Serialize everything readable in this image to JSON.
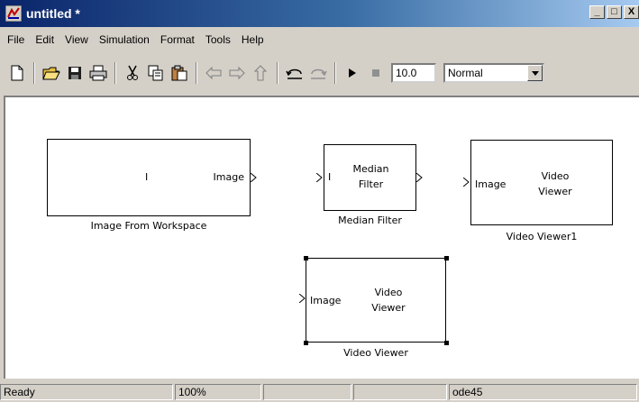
{
  "window": {
    "title": "untitled *",
    "buttons": [
      "_",
      "□",
      "X"
    ]
  },
  "menu": [
    "File",
    "Edit",
    "View",
    "Simulation",
    "Format",
    "Tools",
    "Help"
  ],
  "toolbar": {
    "icons": [
      "new-file-icon",
      "open-folder-icon",
      "save-icon",
      "print-icon",
      "cut-icon",
      "copy-icon",
      "paste-icon",
      "back-arrow-icon",
      "forward-arrow-icon",
      "up-arrow-icon",
      "undo-icon",
      "redo-icon",
      "play-icon",
      "stop-icon"
    ],
    "stop_time": "10.0",
    "sim_mode": "Normal"
  },
  "blocks": {
    "image_from_workspace": {
      "content": "I",
      "out_port": "Image",
      "caption": "Image From Workspace"
    },
    "median_filter": {
      "in_port": "I",
      "line1": "Median",
      "line2": "Filter",
      "caption": "Median Filter"
    },
    "video_viewer1": {
      "in_port": "Image",
      "line1": "Video",
      "line2": "Viewer",
      "caption": "Video Viewer1"
    },
    "video_viewer": {
      "in_port": "Image",
      "line1": "Video",
      "line2": "Viewer",
      "caption": "Video Viewer"
    }
  },
  "status": {
    "state": "Ready",
    "zoom": "100%",
    "cell3": "",
    "cell4": "",
    "solver": "ode45"
  }
}
